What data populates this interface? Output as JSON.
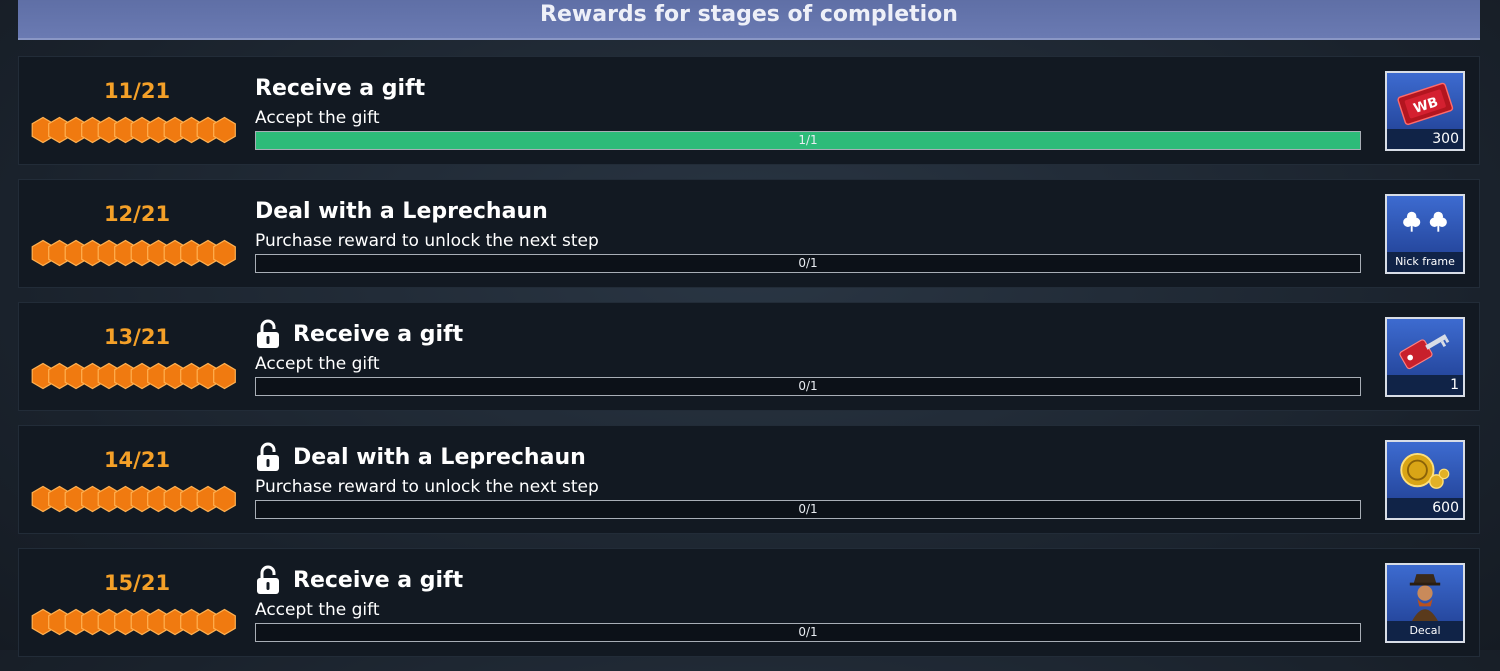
{
  "header": {
    "title": "Rewards for stages of completion"
  },
  "stages": [
    {
      "count": "11/21",
      "locked": false,
      "title": "Receive a gift",
      "description": "Accept the gift",
      "progress_text": "1/1",
      "progress": 1.0,
      "reward": {
        "icon": "wb-ticket-icon",
        "label": "300"
      }
    },
    {
      "count": "12/21",
      "locked": false,
      "title": "Deal with a Leprechaun",
      "description": "Purchase reward to unlock the next step",
      "progress_text": "0/1",
      "progress": 0.0,
      "reward": {
        "icon": "clover-frame-icon",
        "label": "Nick frame"
      }
    },
    {
      "count": "13/21",
      "locked": true,
      "title": "Receive a gift",
      "description": "Accept the gift",
      "progress_text": "0/1",
      "progress": 0.0,
      "reward": {
        "icon": "key-icon",
        "label": "1"
      }
    },
    {
      "count": "14/21",
      "locked": true,
      "title": "Deal with a Leprechaun",
      "description": "Purchase reward to unlock the next step",
      "progress_text": "0/1",
      "progress": 0.0,
      "reward": {
        "icon": "gold-coins-icon",
        "label": "600"
      }
    },
    {
      "count": "15/21",
      "locked": true,
      "title": "Receive a gift",
      "description": "Accept the gift",
      "progress_text": "0/1",
      "progress": 0.0,
      "reward": {
        "icon": "leprechaun-decal-icon",
        "label": "Decal"
      }
    }
  ],
  "colors": {
    "accent_orange": "#f4a028",
    "progress_green": "#2dbb79",
    "header_blue": "#6474ab"
  }
}
